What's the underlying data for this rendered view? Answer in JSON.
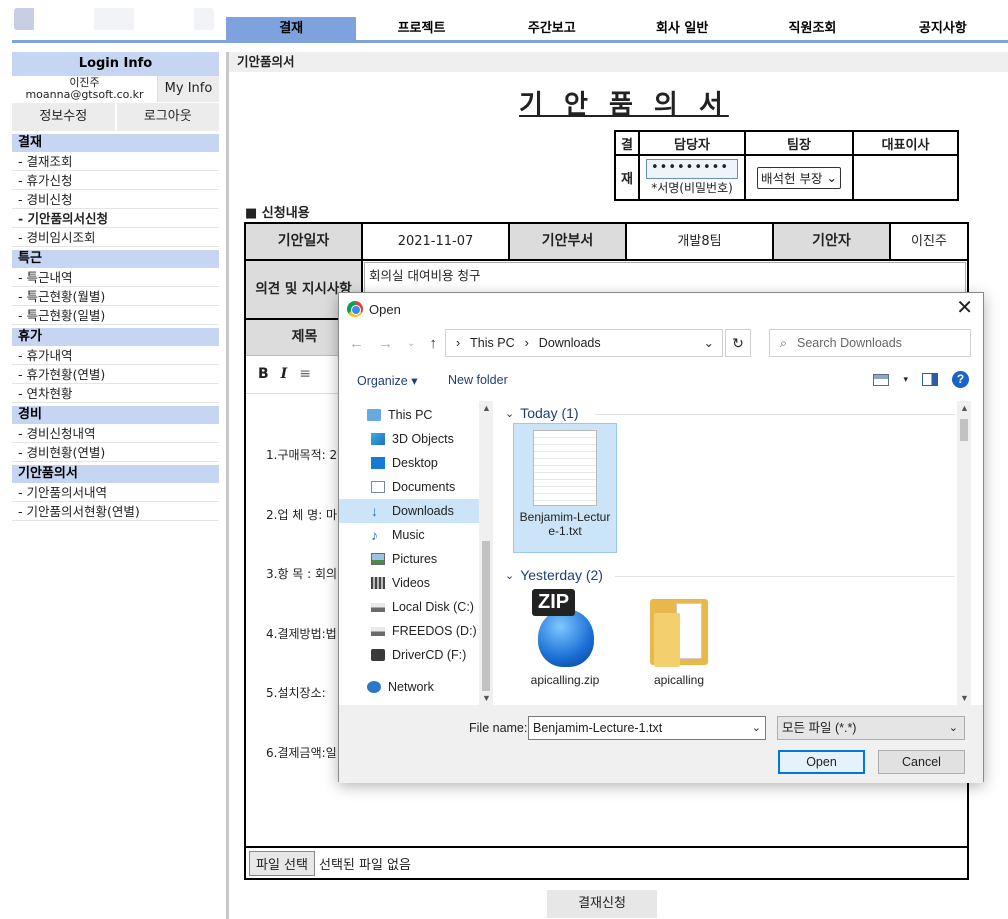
{
  "topnav": {
    "tabs": [
      "결재",
      "프로젝트",
      "주간보고",
      "회사 일반",
      "직원조회",
      "공지사항"
    ],
    "active": 0
  },
  "sidebar": {
    "login_title": "Login Info",
    "user_name": "이진주",
    "user_email": "moanna@gtsoft.co.kr",
    "myinfo_label": "My Info",
    "edit_label": "정보수정",
    "logout_label": "로그아웃",
    "sections": [
      {
        "title": "결재",
        "items": [
          "- 결재조회",
          "- 휴가신청",
          "- 경비신청",
          "- 기안품의서신청",
          "- 경비임시조회"
        ]
      },
      {
        "title": "특근",
        "items": [
          "- 특근내역",
          "- 특근현황(월별)",
          "- 특근현황(일별)"
        ]
      },
      {
        "title": "휴가",
        "items": [
          "- 휴가내역",
          "- 휴가현황(연별)",
          "- 연차현황"
        ]
      },
      {
        "title": "경비",
        "items": [
          "- 경비신청내역",
          "- 경비현황(연별)"
        ]
      },
      {
        "title": "기안품의서",
        "items": [
          "- 기안품의서내역",
          "- 기안품의서현황(연별)"
        ]
      }
    ]
  },
  "main": {
    "breadcrumb": "기안품의서",
    "title": "기 안 품 의 서",
    "approval": {
      "side_top": "결",
      "side_bottom": "재",
      "headers": [
        "담당자",
        "팀장",
        "대표이사"
      ],
      "password_mask": "•••••••••",
      "password_hint": "*서명(비밀번호)",
      "team_lead_selected": "배석헌 부장"
    },
    "section_label": "■ 신청내용",
    "row1": {
      "date_label": "기안일자",
      "date_value": "2021-11-07",
      "dept_label": "기안부서",
      "dept_value": "개발8팀",
      "author_label": "기안자",
      "author_value": "이진주"
    },
    "opinion_label": "의견 및 지시사항",
    "opinion_value": "회의실 대여비용 청구",
    "subject_label": "제목",
    "toolbar": {
      "bold": "B",
      "italic": "I"
    },
    "editor_lines": [
      "1.구매목적: 20",
      "2.업 체 명: 마",
      "3.항 목 : 회의",
      "4.결제방법:법",
      "5.설치장소:",
      "6.결제금액:일"
    ],
    "file_button": "파일 선택",
    "file_status": "선택된 파일 없음",
    "submit_label": "결재신청"
  },
  "dialog": {
    "title": "Open",
    "breadcrumb": [
      "This PC",
      "Downloads"
    ],
    "search_placeholder": "Search Downloads",
    "organize_label": "Organize",
    "new_folder_label": "New folder",
    "nav_items": [
      {
        "label": "This PC",
        "icon": "pc-icon",
        "top": true
      },
      {
        "label": "3D Objects",
        "icon": "3d-objects-icon"
      },
      {
        "label": "Desktop",
        "icon": "desktop-icon"
      },
      {
        "label": "Documents",
        "icon": "documents-icon"
      },
      {
        "label": "Downloads",
        "icon": "downloads-icon",
        "selected": true
      },
      {
        "label": "Music",
        "icon": "music-icon"
      },
      {
        "label": "Pictures",
        "icon": "pictures-icon"
      },
      {
        "label": "Videos",
        "icon": "videos-icon"
      },
      {
        "label": "Local Disk (C:)",
        "icon": "local-disk-icon"
      },
      {
        "label": "FREEDOS (D:)",
        "icon": "drive-icon"
      },
      {
        "label": "DriverCD (F:)",
        "icon": "cd-drive-icon"
      },
      {
        "label": "Network",
        "icon": "network-icon",
        "top": true
      }
    ],
    "groups": [
      {
        "label": "Today (1)",
        "files": [
          {
            "name": "Benjamim-Lecture-1.txt",
            "icon": "text-file-icon",
            "selected": true
          }
        ]
      },
      {
        "label": "Yesterday (2)",
        "files": [
          {
            "name": "apicalling.zip",
            "icon": "zip-file-icon"
          },
          {
            "name": "apicalling",
            "icon": "folder-icon"
          }
        ]
      }
    ],
    "file_name_label": "File name:",
    "file_name_value": "Benjamim-Lecture-1.txt",
    "file_type": "모든 파일 (*.*)",
    "open_label": "Open",
    "cancel_label": "Cancel"
  }
}
